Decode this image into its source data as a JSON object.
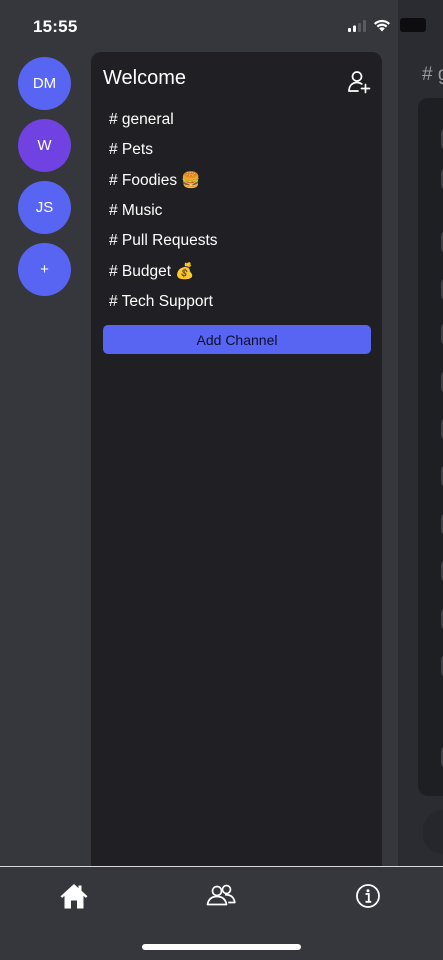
{
  "status_bar": {
    "time": "15:55"
  },
  "servers": [
    {
      "label": "DM",
      "color": "#5865f2"
    },
    {
      "label": "W",
      "color": "#6f42e1"
    },
    {
      "label": "JS",
      "color": "#5865f2"
    },
    {
      "label": "+",
      "color": "#5865f2"
    }
  ],
  "channels_panel": {
    "title": "Welcome",
    "items": [
      {
        "label": "# general"
      },
      {
        "label": "# Pets"
      },
      {
        "label": "# Foodies 🍔"
      },
      {
        "label": "# Music"
      },
      {
        "label": "# Pull Requests"
      },
      {
        "label": "# Budget 💰"
      },
      {
        "label": "# Tech Support"
      }
    ],
    "add_channel_label": "Add Channel"
  },
  "right_panel": {
    "channel_title": "# g"
  },
  "tab_bar": {
    "tabs": [
      {
        "icon": "home-icon"
      },
      {
        "icon": "people-icon"
      },
      {
        "icon": "info-icon"
      }
    ]
  }
}
